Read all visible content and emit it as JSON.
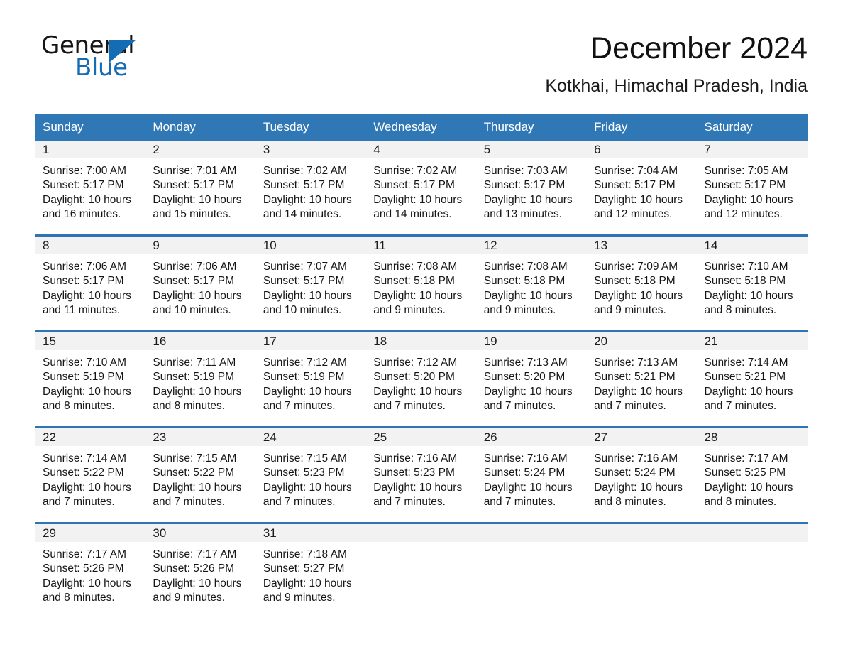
{
  "logo": {
    "word_one": "General",
    "word_two": "Blue",
    "triangle_color": "#146cb4",
    "icon": "triangle-icon"
  },
  "header": {
    "title": "December 2024",
    "location": "Kotkhai, Himachal Pradesh, India",
    "header_bg": "#3077b5",
    "row_divider_color": "#2e74b4",
    "daynum_bg": "#f2f2f2"
  },
  "calendar": {
    "weekdays": [
      "Sunday",
      "Monday",
      "Tuesday",
      "Wednesday",
      "Thursday",
      "Friday",
      "Saturday"
    ],
    "weeks": [
      [
        {
          "day": "1",
          "sunrise": "Sunrise: 7:00 AM",
          "sunset": "Sunset: 5:17 PM",
          "daylight_1": "Daylight: 10 hours",
          "daylight_2": "and 16 minutes."
        },
        {
          "day": "2",
          "sunrise": "Sunrise: 7:01 AM",
          "sunset": "Sunset: 5:17 PM",
          "daylight_1": "Daylight: 10 hours",
          "daylight_2": "and 15 minutes."
        },
        {
          "day": "3",
          "sunrise": "Sunrise: 7:02 AM",
          "sunset": "Sunset: 5:17 PM",
          "daylight_1": "Daylight: 10 hours",
          "daylight_2": "and 14 minutes."
        },
        {
          "day": "4",
          "sunrise": "Sunrise: 7:02 AM",
          "sunset": "Sunset: 5:17 PM",
          "daylight_1": "Daylight: 10 hours",
          "daylight_2": "and 14 minutes."
        },
        {
          "day": "5",
          "sunrise": "Sunrise: 7:03 AM",
          "sunset": "Sunset: 5:17 PM",
          "daylight_1": "Daylight: 10 hours",
          "daylight_2": "and 13 minutes."
        },
        {
          "day": "6",
          "sunrise": "Sunrise: 7:04 AM",
          "sunset": "Sunset: 5:17 PM",
          "daylight_1": "Daylight: 10 hours",
          "daylight_2": "and 12 minutes."
        },
        {
          "day": "7",
          "sunrise": "Sunrise: 7:05 AM",
          "sunset": "Sunset: 5:17 PM",
          "daylight_1": "Daylight: 10 hours",
          "daylight_2": "and 12 minutes."
        }
      ],
      [
        {
          "day": "8",
          "sunrise": "Sunrise: 7:06 AM",
          "sunset": "Sunset: 5:17 PM",
          "daylight_1": "Daylight: 10 hours",
          "daylight_2": "and 11 minutes."
        },
        {
          "day": "9",
          "sunrise": "Sunrise: 7:06 AM",
          "sunset": "Sunset: 5:17 PM",
          "daylight_1": "Daylight: 10 hours",
          "daylight_2": "and 10 minutes."
        },
        {
          "day": "10",
          "sunrise": "Sunrise: 7:07 AM",
          "sunset": "Sunset: 5:17 PM",
          "daylight_1": "Daylight: 10 hours",
          "daylight_2": "and 10 minutes."
        },
        {
          "day": "11",
          "sunrise": "Sunrise: 7:08 AM",
          "sunset": "Sunset: 5:18 PM",
          "daylight_1": "Daylight: 10 hours",
          "daylight_2": "and 9 minutes."
        },
        {
          "day": "12",
          "sunrise": "Sunrise: 7:08 AM",
          "sunset": "Sunset: 5:18 PM",
          "daylight_1": "Daylight: 10 hours",
          "daylight_2": "and 9 minutes."
        },
        {
          "day": "13",
          "sunrise": "Sunrise: 7:09 AM",
          "sunset": "Sunset: 5:18 PM",
          "daylight_1": "Daylight: 10 hours",
          "daylight_2": "and 9 minutes."
        },
        {
          "day": "14",
          "sunrise": "Sunrise: 7:10 AM",
          "sunset": "Sunset: 5:18 PM",
          "daylight_1": "Daylight: 10 hours",
          "daylight_2": "and 8 minutes."
        }
      ],
      [
        {
          "day": "15",
          "sunrise": "Sunrise: 7:10 AM",
          "sunset": "Sunset: 5:19 PM",
          "daylight_1": "Daylight: 10 hours",
          "daylight_2": "and 8 minutes."
        },
        {
          "day": "16",
          "sunrise": "Sunrise: 7:11 AM",
          "sunset": "Sunset: 5:19 PM",
          "daylight_1": "Daylight: 10 hours",
          "daylight_2": "and 8 minutes."
        },
        {
          "day": "17",
          "sunrise": "Sunrise: 7:12 AM",
          "sunset": "Sunset: 5:19 PM",
          "daylight_1": "Daylight: 10 hours",
          "daylight_2": "and 7 minutes."
        },
        {
          "day": "18",
          "sunrise": "Sunrise: 7:12 AM",
          "sunset": "Sunset: 5:20 PM",
          "daylight_1": "Daylight: 10 hours",
          "daylight_2": "and 7 minutes."
        },
        {
          "day": "19",
          "sunrise": "Sunrise: 7:13 AM",
          "sunset": "Sunset: 5:20 PM",
          "daylight_1": "Daylight: 10 hours",
          "daylight_2": "and 7 minutes."
        },
        {
          "day": "20",
          "sunrise": "Sunrise: 7:13 AM",
          "sunset": "Sunset: 5:21 PM",
          "daylight_1": "Daylight: 10 hours",
          "daylight_2": "and 7 minutes."
        },
        {
          "day": "21",
          "sunrise": "Sunrise: 7:14 AM",
          "sunset": "Sunset: 5:21 PM",
          "daylight_1": "Daylight: 10 hours",
          "daylight_2": "and 7 minutes."
        }
      ],
      [
        {
          "day": "22",
          "sunrise": "Sunrise: 7:14 AM",
          "sunset": "Sunset: 5:22 PM",
          "daylight_1": "Daylight: 10 hours",
          "daylight_2": "and 7 minutes."
        },
        {
          "day": "23",
          "sunrise": "Sunrise: 7:15 AM",
          "sunset": "Sunset: 5:22 PM",
          "daylight_1": "Daylight: 10 hours",
          "daylight_2": "and 7 minutes."
        },
        {
          "day": "24",
          "sunrise": "Sunrise: 7:15 AM",
          "sunset": "Sunset: 5:23 PM",
          "daylight_1": "Daylight: 10 hours",
          "daylight_2": "and 7 minutes."
        },
        {
          "day": "25",
          "sunrise": "Sunrise: 7:16 AM",
          "sunset": "Sunset: 5:23 PM",
          "daylight_1": "Daylight: 10 hours",
          "daylight_2": "and 7 minutes."
        },
        {
          "day": "26",
          "sunrise": "Sunrise: 7:16 AM",
          "sunset": "Sunset: 5:24 PM",
          "daylight_1": "Daylight: 10 hours",
          "daylight_2": "and 7 minutes."
        },
        {
          "day": "27",
          "sunrise": "Sunrise: 7:16 AM",
          "sunset": "Sunset: 5:24 PM",
          "daylight_1": "Daylight: 10 hours",
          "daylight_2": "and 8 minutes."
        },
        {
          "day": "28",
          "sunrise": "Sunrise: 7:17 AM",
          "sunset": "Sunset: 5:25 PM",
          "daylight_1": "Daylight: 10 hours",
          "daylight_2": "and 8 minutes."
        }
      ],
      [
        {
          "day": "29",
          "sunrise": "Sunrise: 7:17 AM",
          "sunset": "Sunset: 5:26 PM",
          "daylight_1": "Daylight: 10 hours",
          "daylight_2": "and 8 minutes."
        },
        {
          "day": "30",
          "sunrise": "Sunrise: 7:17 AM",
          "sunset": "Sunset: 5:26 PM",
          "daylight_1": "Daylight: 10 hours",
          "daylight_2": "and 9 minutes."
        },
        {
          "day": "31",
          "sunrise": "Sunrise: 7:18 AM",
          "sunset": "Sunset: 5:27 PM",
          "daylight_1": "Daylight: 10 hours",
          "daylight_2": "and 9 minutes."
        },
        {
          "day": "",
          "sunrise": "",
          "sunset": "",
          "daylight_1": "",
          "daylight_2": ""
        },
        {
          "day": "",
          "sunrise": "",
          "sunset": "",
          "daylight_1": "",
          "daylight_2": ""
        },
        {
          "day": "",
          "sunrise": "",
          "sunset": "",
          "daylight_1": "",
          "daylight_2": ""
        },
        {
          "day": "",
          "sunrise": "",
          "sunset": "",
          "daylight_1": "",
          "daylight_2": ""
        }
      ]
    ]
  }
}
